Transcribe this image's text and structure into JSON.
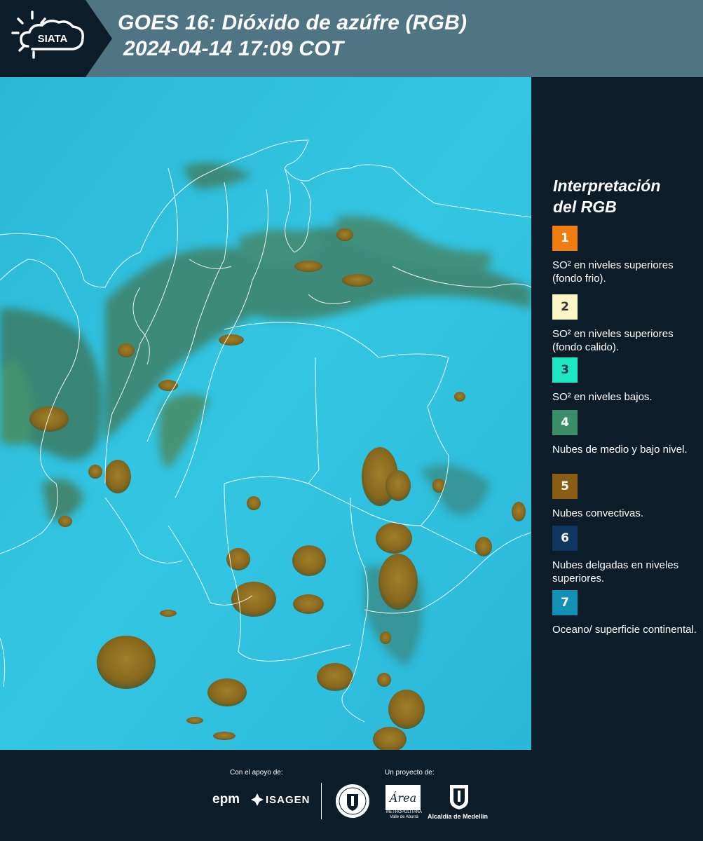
{
  "header": {
    "logo_text": "SIATA",
    "title_line1": "GOES 16: Dióxido de azúfre (RGB)",
    "title_line2": "2024-04-14 17:09 COT"
  },
  "legend": {
    "title_line1": "Interpretación",
    "title_line2": "del RGB",
    "items": [
      {
        "number": "1",
        "color": "#f07c12",
        "text_color": "#ffffff",
        "label": "SO² en niveles superiores (fondo frio)."
      },
      {
        "number": "2",
        "color": "#fbf6c6",
        "text_color": "#333333",
        "label": "SO² en niveles superiores (fondo calido)."
      },
      {
        "number": "3",
        "color": "#1ee8c4",
        "text_color": "#1a3a4a",
        "label": "SO² en niveles bajos."
      },
      {
        "number": "4",
        "color": "#3c8e68",
        "text_color": "#ffffff",
        "label": "Nubes de medio y bajo nivel."
      },
      {
        "number": "5",
        "color": "#8b5c14",
        "text_color": "#ffffff",
        "label": "Nubes convectivas."
      },
      {
        "number": "6",
        "color": "#0f3660",
        "text_color": "#ffffff",
        "label": "Nubes delgadas en niveles superiores."
      },
      {
        "number": "7",
        "color": "#1390b6",
        "text_color": "#ffffff",
        "label": "Oceano/ superficie continental."
      }
    ]
  },
  "footer": {
    "support_label": "Con el apoyo de:",
    "project_label": "Un proyecto de:",
    "epm_logo": "epm",
    "isagen_logo": "ISAGEN",
    "area_logo_script": "Área",
    "area_logo_text": "METROPOLITANA Valle de Aburrá",
    "alcaldia_text": "Alcaldía de Medellín"
  },
  "colors": {
    "header_bg": "#4f7584",
    "panel_bg": "#0c1c28",
    "ocean": "#22b6d8",
    "convective_cloud": "#8b6a1c",
    "low_cloud": "#4f8a62"
  }
}
